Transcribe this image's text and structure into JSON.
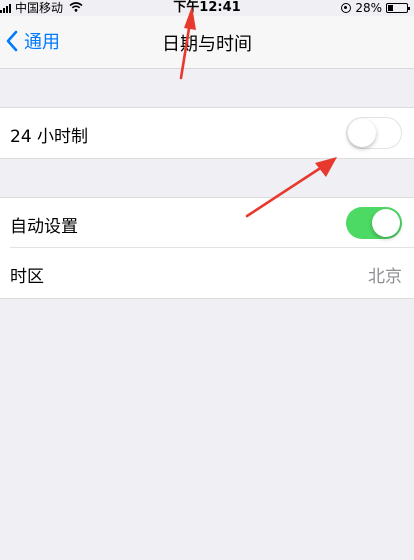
{
  "status_bar": {
    "carrier": "中国移动",
    "time": "下午12:41",
    "battery_percent": "28%",
    "battery_level": 0.28
  },
  "nav": {
    "back_label": "通用",
    "title": "日期与时间"
  },
  "settings": {
    "hour24": {
      "label": "24 小时制",
      "enabled": false
    },
    "auto_set": {
      "label": "自动设置",
      "enabled": true
    },
    "timezone": {
      "label": "时区",
      "value": "北京"
    }
  },
  "colors": {
    "accent": "#007aff",
    "toggle_on": "#4cd964",
    "annotation_arrow": "#e8392f"
  },
  "icons": [
    "signal-bars-icon",
    "wifi-icon",
    "orientation-lock-icon",
    "battery-icon",
    "chevron-left-icon",
    "annotation-arrow-icon"
  ]
}
